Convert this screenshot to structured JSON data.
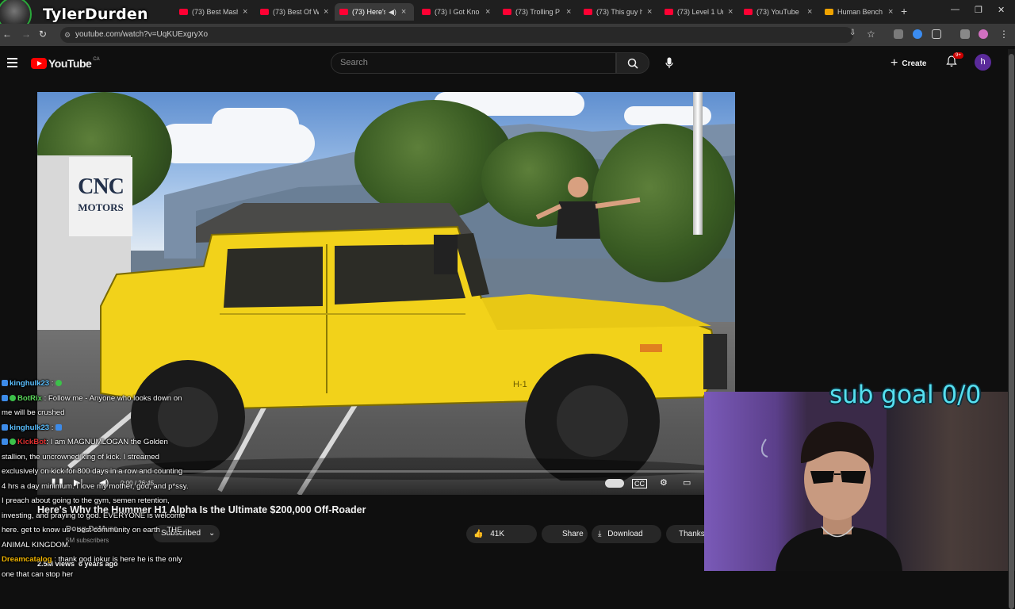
{
  "browser": {
    "tabs": [
      {
        "label": "(73) Best Mash",
        "active": false
      },
      {
        "label": "(73) Best Of W",
        "active": false
      },
      {
        "label": "(73) Here's",
        "active": true,
        "audio": true
      },
      {
        "label": "(73) I Got Kno",
        "active": false
      },
      {
        "label": "(73) Trolling P",
        "active": false
      },
      {
        "label": "(73) This guy h",
        "active": false
      },
      {
        "label": "(73) Level 1 Un",
        "active": false
      },
      {
        "label": "(73) YouTube",
        "active": false
      },
      {
        "label": "Human Bench",
        "active": false
      }
    ],
    "url": "youtube.com/watch?v=UqKUExgryXo"
  },
  "streamer": {
    "name": "TylerDurden"
  },
  "youtube": {
    "logo": "YouTube",
    "country_code": "CA",
    "search_placeholder": "Search",
    "create_label": "Create",
    "notif_badge": "9+",
    "avatar_letter": "h"
  },
  "video": {
    "title": "Here's Why the Hummer H1 Alpha Is the Ultimate $200,000 Off-Roader",
    "time": "0:00 / 26:45",
    "sign_line1": "CNC",
    "sign_line2": "MOTORS",
    "plate": "H-1",
    "channel": "Doug DeMuro",
    "subscribers": "5M subscribers",
    "subscribed_label": "Subscribed",
    "likes": "41K",
    "share_label": "Share",
    "download_label": "Download",
    "thanks_label": "Thanks",
    "views": "2.5M views",
    "age": "6 years ago"
  },
  "chat": [
    {
      "user": "kinghulk23",
      "user_color": "#5bc0ff",
      "text": ""
    },
    {
      "user": "BotRix",
      "user_color": "#5bd65b",
      "text": "Follow me - Anyone who looks down on me will be crushed"
    },
    {
      "user": "kinghulk23",
      "user_color": "#5bc0ff",
      "text": ""
    },
    {
      "user": "KickBot",
      "user_color": "#e03030",
      "text": "I am MAGNUMLOGAN the Golden stallion, the uncrowned king of kick. I streamed exclusively on kick for 800 days in a row and counting 4 hrs a day minimum. I love my mother, god, and p*ssy. I preach about going to the gym, semen retention, investing, and praying to god. EVERYONE is welcome here. get to know us - best community on earth - THE ANIMAL KINGDOM."
    },
    {
      "user": "Dreamcatalog",
      "user_color": "#f0b400",
      "text": "thank god jokur is here he is the only one that can stop her"
    }
  ],
  "overlay": {
    "sub_goal": "sub goal 0/0"
  },
  "colors": {
    "yt_red": "#ff0000",
    "hummer_yellow": "#f2d21a",
    "subgoal_cyan": "#56e0f0"
  }
}
